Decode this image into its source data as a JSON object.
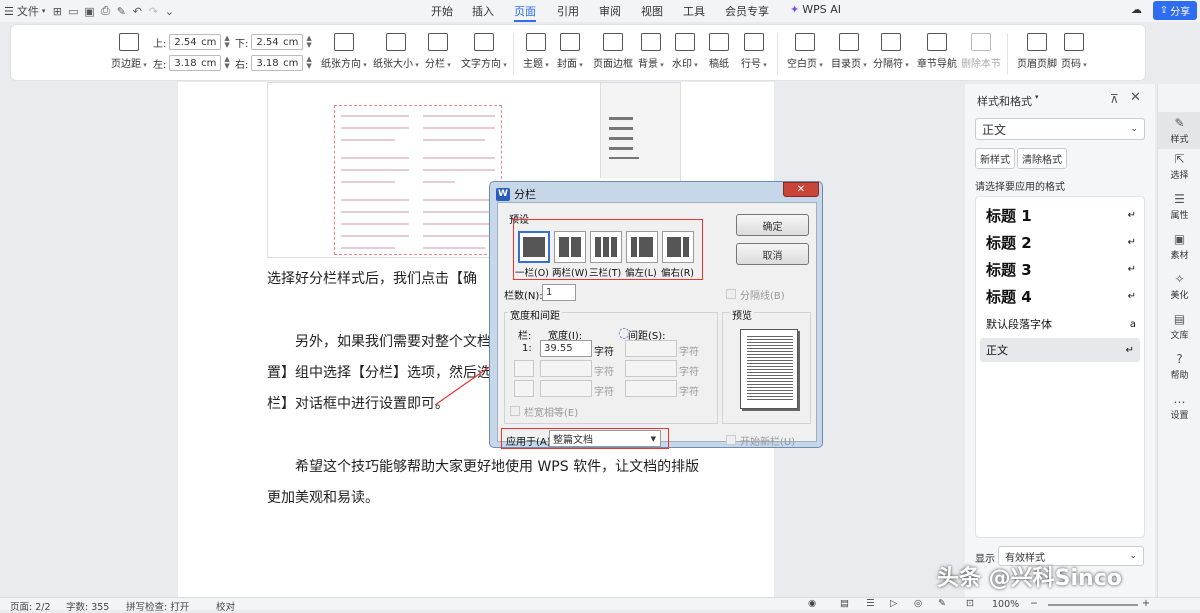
{
  "menubar": {
    "file": "文件",
    "tabs": [
      "开始",
      "插入",
      "页面",
      "引用",
      "审阅",
      "视图",
      "工具",
      "会员专享"
    ],
    "active_tab": "页面",
    "wps_ai": "WPS AI",
    "share": "分享"
  },
  "ribbon": {
    "margins_label": "页边距",
    "top_label": "上:",
    "top": "2.54",
    "bottom_label": "下:",
    "bottom": "2.54",
    "left_label": "左:",
    "left": "3.18",
    "right_label": "右:",
    "right": "3.18",
    "unit": "cm",
    "items": [
      "纸张方向",
      "纸张大小",
      "分栏",
      "文字方向",
      "主题",
      "封面",
      "页面边框",
      "背景",
      "水印",
      "稿纸",
      "行号",
      "空白页",
      "目录页",
      "分隔符",
      "章节导航",
      "删除本节",
      "页眉页脚",
      "页码"
    ]
  },
  "document": {
    "p1": "选择好分栏样式后，我们点击【确",
    "p2a": "另外，如果我们需要对整个文档",
    "p2b": "置】组中选择【分栏】选项，然后选",
    "p2c": "栏】对话框中进行设置即可。",
    "p3a": "希望这个技巧能够帮助大家更好地使用 WPS 软件，让文档的排版",
    "p3b": "更加美观和易读。"
  },
  "dialog": {
    "title": "分栏",
    "presets_label": "预设",
    "presets": [
      "一栏(O)",
      "两栏(W)",
      "三栏(T)",
      "偏左(L)",
      "偏右(R)"
    ],
    "ok": "确定",
    "cancel": "取消",
    "cols_label": "栏数(N):",
    "cols_value": "1",
    "separator": "分隔线(B)",
    "width_spacing": "宽度和间距",
    "col_header": "栏:",
    "width_header": "宽度(I):",
    "spacing_header": "间距(S):",
    "row1_num": "1:",
    "row1_width": "39.55",
    "unit": "字符",
    "equal_width": "栏宽相等(E)",
    "preview": "预览",
    "apply_label": "应用于(A):",
    "apply_value": "整篇文档",
    "new_column": "开始新栏(U)"
  },
  "sidepanel": {
    "title": "样式和格式",
    "current": "正文",
    "new_style": "新样式",
    "clear_format": "清除格式",
    "prompt": "请选择要应用的格式",
    "styles": [
      "标题 1",
      "标题 2",
      "标题 3",
      "标题 4",
      "默认段落字体",
      "正文"
    ],
    "show_label": "显示",
    "show_value": "有效样式"
  },
  "rightbar": [
    "样式",
    "选择",
    "属性",
    "素材",
    "美化",
    "文库",
    "帮助",
    "设置"
  ],
  "status": {
    "page": "页面: 2/2",
    "words": "字数: 355",
    "spell": "拼写检查: 打开",
    "proof": "校对",
    "zoom": "100%"
  },
  "watermark": "头条 @兴科Sinco"
}
